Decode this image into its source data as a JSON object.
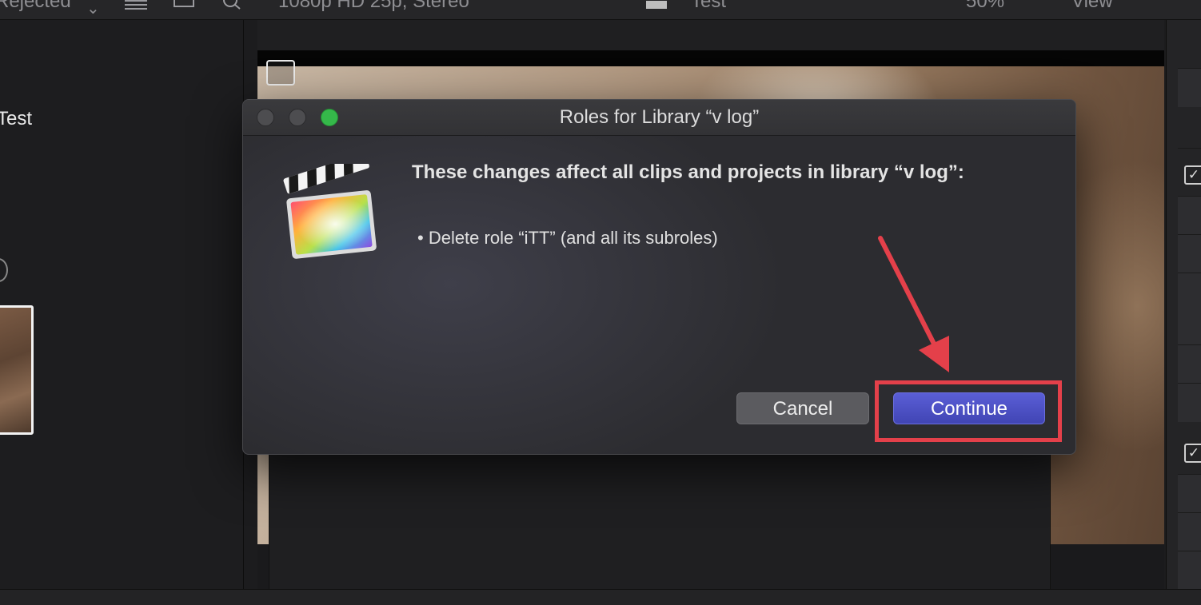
{
  "background": {
    "top_fragments": [
      "Rejected",
      "1080p HD 25p, Stereo",
      "Test",
      "50%",
      "View"
    ],
    "project_label": "Test"
  },
  "dialog": {
    "title": "Roles for Library “v log”",
    "headline": "These changes affect all clips and projects in library “v log”:",
    "bullet": "• Delete role “iTT” (and all its subroles)",
    "cancel_label": "Cancel",
    "continue_label": "Continue",
    "app_icon": "final-cut-pro-clapperboard-icon"
  },
  "colors": {
    "accent_button": "#4a4ec4",
    "annotation": "#e4404a",
    "zoom_button": "#35b84a"
  }
}
